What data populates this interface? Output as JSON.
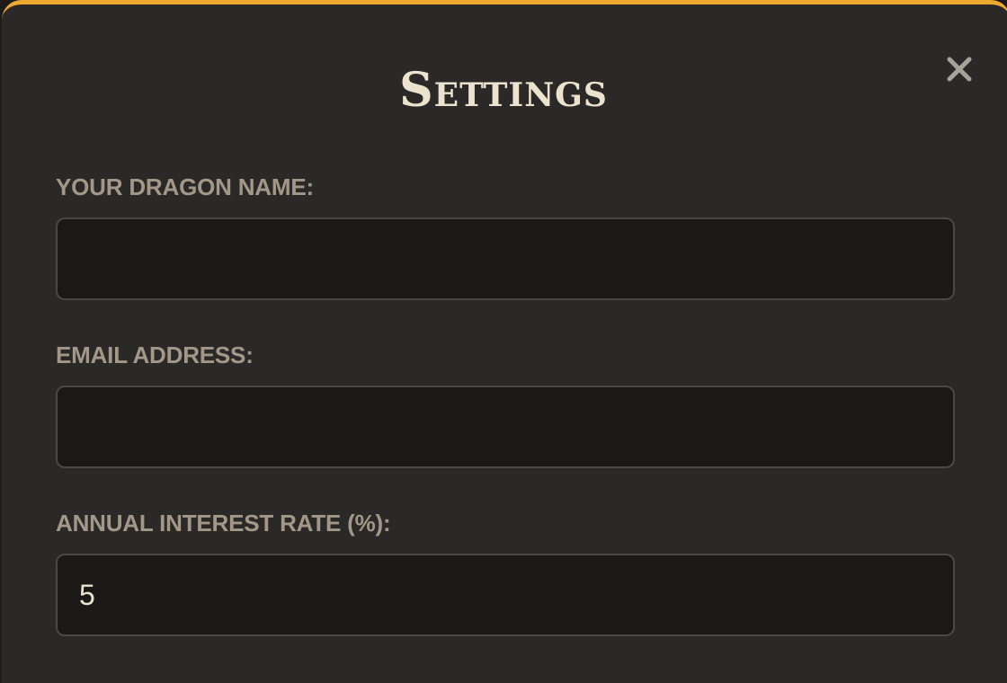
{
  "dialog": {
    "title": "Settings",
    "close_icon": "close-icon",
    "accent_color": "#f0a930"
  },
  "fields": [
    {
      "label": "YOUR DRAGON NAME:",
      "value": ""
    },
    {
      "label": "EMAIL ADDRESS:",
      "value": ""
    },
    {
      "label": "ANNUAL INTEREST RATE (%):",
      "value": "5"
    }
  ]
}
